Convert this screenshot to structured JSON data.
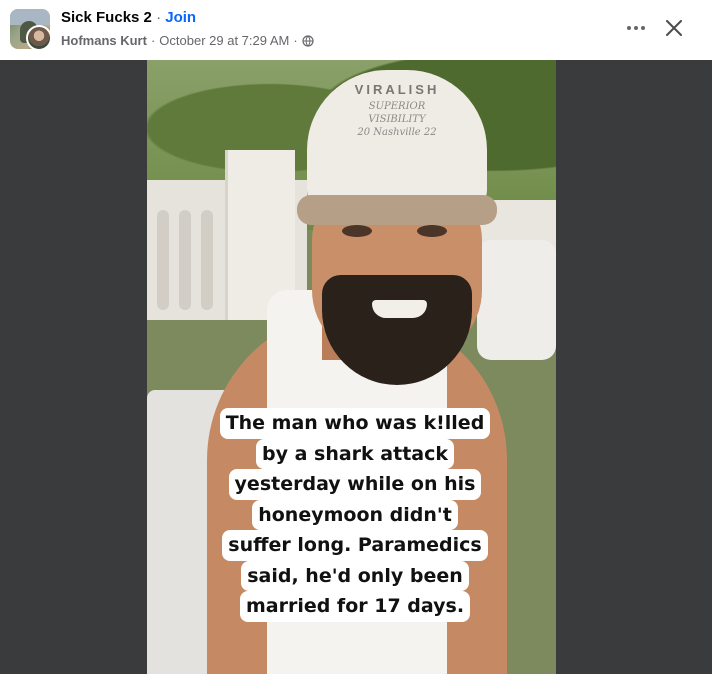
{
  "header": {
    "group_name": "Sick Fucks 2",
    "separator": "·",
    "join_label": "Join",
    "author": "Hofmans Kurt",
    "meta_separator": "·",
    "timestamp": "October 29 at 7:29 AM",
    "meta_separator_2": "·",
    "privacy_icon": "globe-icon",
    "more_icon": "more-horizontal-icon",
    "close_icon": "close-icon"
  },
  "video": {
    "cap": {
      "brand": "VIRALISH",
      "line1": "SUPERIOR",
      "line2": "VISIBILITY",
      "line3": "20 Nashville 22"
    },
    "caption_lines": [
      "The man who was k!lled",
      "by a shark attack",
      "yesterday while on his",
      "honeymoon didn't",
      "suffer long. Paramedics",
      "said, he'd only been",
      "married for 17 days."
    ]
  },
  "colors": {
    "link_blue": "#0866ff",
    "secondary_text": "#65676b",
    "media_background": "#3a3b3c"
  }
}
